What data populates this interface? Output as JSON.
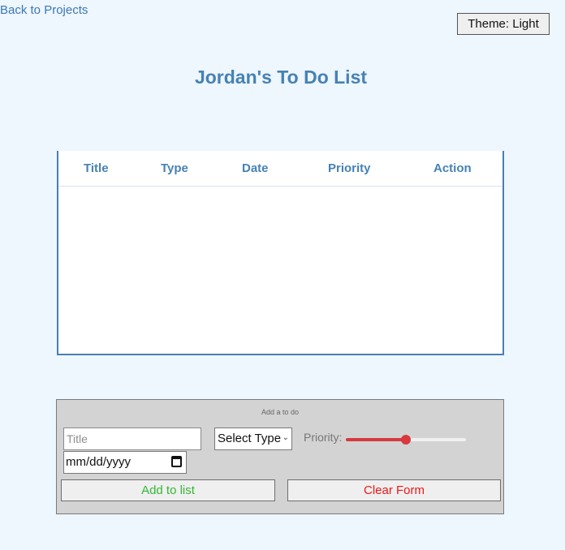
{
  "nav": {
    "back_label": "Back to Projects"
  },
  "theme": {
    "button_label": "Theme: Light"
  },
  "page": {
    "title": "Jordan's To Do List"
  },
  "table": {
    "headers": [
      "Title",
      "Type",
      "Date",
      "Priority",
      "Action"
    ],
    "rows": []
  },
  "form": {
    "caption": "Add a to do",
    "title_placeholder": "Title",
    "type_select_value": "Select Type",
    "priority_label": "Priority:",
    "priority_value": 0.5,
    "date_value": "mm/dd/yyyy",
    "add_label": "Add to list",
    "clear_label": "Clear Form"
  },
  "colors": {
    "background": "#eef6fe",
    "accent": "#4682b4",
    "slider_fill": "#d9383f",
    "add_text": "#33b833",
    "clear_text": "#f01515"
  },
  "icons": {
    "type_select": "chevron-down-icon",
    "date_input": "calendar-icon"
  }
}
